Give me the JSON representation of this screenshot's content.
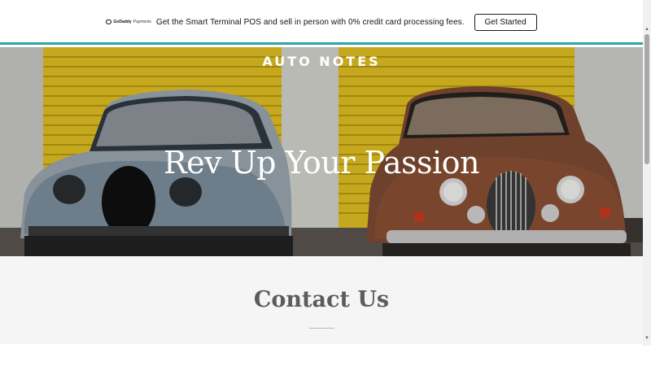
{
  "promo": {
    "logo_name": "GoDaddy",
    "logo_suffix": "Payments",
    "text": "Get the Smart Terminal POS and sell in person with 0% credit card processing fees.",
    "button_label": "Get Started"
  },
  "hero": {
    "site_title": "AUTO NOTES",
    "heading": "Rev Up Your Passion"
  },
  "contact": {
    "heading": "Contact Us"
  },
  "icons": {
    "logo": "godaddy-logo-icon",
    "scroll_up": "arrow-up-icon",
    "scroll_down": "arrow-down-icon"
  },
  "colors": {
    "accent_bar": "#2aa6a4",
    "door_yellow": "#e7c624",
    "contact_bg": "#f5f5f5"
  }
}
